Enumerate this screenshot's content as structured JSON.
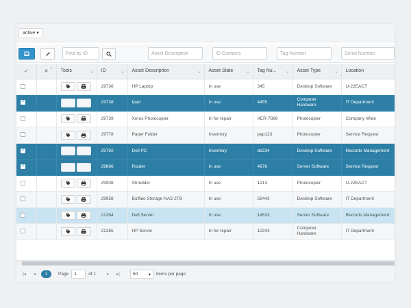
{
  "filter": {
    "state_label": "active",
    "caret": "▾"
  },
  "toolbar": {
    "find_by_id_placeholder": "Find by ID",
    "asset_description_placeholder": "Asset Description",
    "id_contains_placeholder": "ID Contains",
    "tag_number_placeholder": "Tag Number",
    "serial_number_placeholder": "Serial Number"
  },
  "colors": {
    "accent": "#3393cb",
    "selected_row": "#2d7fa6",
    "hover_row": "#c8e3f2"
  },
  "columns": [
    "Tools",
    "ID",
    "Asset Description",
    "Asset State",
    "Tag Nu...",
    "Asset Type",
    "Location"
  ],
  "rows": [
    {
      "id": "29736",
      "description": "HP Laptop",
      "state": "In use",
      "tag": "345",
      "type": "Desktop Software",
      "location": "U-22EACT",
      "selected": false
    },
    {
      "id": "29738",
      "description": "Ipad",
      "state": "In use",
      "tag": "4455",
      "type": "Computer Hardware",
      "location": "IT Department",
      "selected": true
    },
    {
      "id": "29739",
      "description": "Xerox Photocopier",
      "state": "In for repair",
      "tag": "XER-7889",
      "type": "Photocopier",
      "location": "Company Wide",
      "selected": false
    },
    {
      "id": "29778",
      "description": "Paper Folder",
      "state": "Inventory",
      "tag": "pap123",
      "type": "Photocopier",
      "location": "Service Request",
      "selected": false
    },
    {
      "id": "29792",
      "description": "Dell PC",
      "state": "Inventory",
      "tag": "de234",
      "type": "Desktop Software",
      "location": "Records Management",
      "selected": true
    },
    {
      "id": "29866",
      "description": "Router",
      "state": "In use",
      "tag": "4978",
      "type": "Server Software",
      "location": "Service Request",
      "selected": true
    },
    {
      "id": "29908",
      "description": "Shredder",
      "state": "In use",
      "tag": "1213",
      "type": "Photocopier",
      "location": "U-22EACT",
      "selected": false
    },
    {
      "id": "29958",
      "description": "Buffalo Storage NAS 2TB",
      "state": "In use",
      "tag": "56443",
      "type": "Desktop Software",
      "location": "IT Department",
      "selected": false
    },
    {
      "id": "21264",
      "description": "Dell Server",
      "state": "In use",
      "tag": "14533",
      "type": "Server Software",
      "location": "Records Management",
      "selected": false,
      "hover": true
    },
    {
      "id": "21265",
      "description": "HP Server",
      "state": "In for repair",
      "tag": "12343",
      "type": "Computer Hardware",
      "location": "IT Department",
      "selected": false
    }
  ],
  "pager": {
    "current_page": "1",
    "page_label": "Page",
    "page_value": "1",
    "of_label": "of 1",
    "page_size": "50",
    "items_label": "items per page"
  },
  "icons": {
    "first": "|◂",
    "prev": "◂",
    "next": "▸",
    "last": "▸|"
  }
}
